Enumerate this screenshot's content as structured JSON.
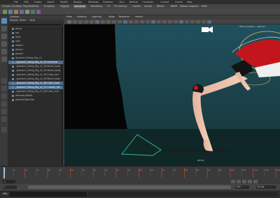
{
  "menubar": {
    "items": [
      "File",
      "Edit",
      "Create",
      "Select",
      "Modify",
      "Display",
      "Windows",
      "Skeleton",
      "Skin",
      "Deform",
      "Constrain",
      "Control",
      "Cache",
      "Help"
    ]
  },
  "shelf_tabs": [
    "Curves / Surfaces",
    "Poly Modeling",
    "Sculpting",
    "Rigging",
    "Animation",
    "Rendering",
    "FX",
    "FX Caching",
    "Custom",
    "Arnold",
    "Bifrost",
    "MASH",
    "Motion Graphics",
    "XGen"
  ],
  "active_shelf_tab": "Animation",
  "outliner": {
    "title": "Outliner",
    "menu": [
      "Display",
      "Show",
      "Help"
    ],
    "items": [
      {
        "label": "persp",
        "selected": false
      },
      {
        "label": "top",
        "selected": false
      },
      {
        "label": "front",
        "selected": false
      },
      {
        "label": "side",
        "selected": false
      },
      {
        "label": "Stage1",
        "selected": false
      },
      {
        "label": "group1",
        "selected": false
      },
      {
        "label": "group2",
        "selected": false
      },
      {
        "label": "Ayanami_Swing_Rig_v1:",
        "selected": false
      },
      {
        "label": "_Ayanami_Swing_Rig_v1_01:character",
        "selected": true
      },
      {
        "label": "_Ayanami_Swing_Rig_v1_02:blend_hook",
        "selected": false
      },
      {
        "label": "_Ayanami_Swing_Rig_v1_03:whole_body",
        "selected": false
      },
      {
        "label": "_Ayanami_Swing_Rig_v1_04:Cross_hair",
        "selected": false
      },
      {
        "label": "_Ayanami_Swing_Rig_v1_05:Blend_hook",
        "selected": false
      },
      {
        "label": "_Ayanami_Swing_Rig_v1_06:Cloth_hook",
        "selected": true
      },
      {
        "label": "_Ayanami_Swing_Rig_v1_07:Control_Set",
        "selected": true
      },
      {
        "label": "_Ayanami_Swing_Rig_v1_08:Cross_hair",
        "selected": false
      },
      {
        "label": "defaultLightSet",
        "selected": false
      },
      {
        "label": "defaultObjectSet",
        "selected": false
      }
    ]
  },
  "viewport": {
    "menu": [
      "View",
      "Shading",
      "Lighting",
      "Show",
      "Renderer",
      "Panels"
    ],
    "camera_label": "persp",
    "corner_label": "XGen preview — Paused"
  },
  "timeline": {
    "current_frame": "1",
    "ticks": [
      "1",
      "5",
      "10",
      "15",
      "20",
      "25",
      "30",
      "35",
      "40",
      "45",
      "50",
      "55",
      "60",
      "65",
      "70",
      "75",
      "80",
      "85",
      "90",
      "95",
      "100",
      "105",
      "110",
      "115",
      "120"
    ],
    "range_start": "1",
    "range_end": "120",
    "range_start_field": "1",
    "range_end_field": "120",
    "fps": "24 fps"
  },
  "cmdline": {
    "label": "MEL",
    "status": ""
  },
  "colors": {
    "accent": "#5285a6",
    "keyframe": "#c2372d",
    "selection": "#4f6f8f",
    "costume_red": "#c3161c",
    "skin": "#efc6b0"
  }
}
